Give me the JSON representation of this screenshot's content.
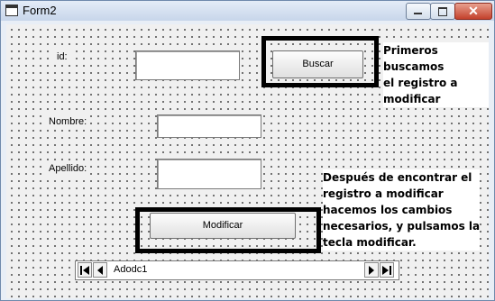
{
  "window": {
    "title": "Form2"
  },
  "form": {
    "id_label": "id:",
    "id_value": "",
    "search_button": "Buscar",
    "name_label": "Nombre:",
    "name_value": "",
    "surname_label": "Apellido:",
    "surname_value": "",
    "modify_button": "Modificar",
    "adodc_caption": "Adodc1"
  },
  "annotations": {
    "note_search": [
      "Primeros buscamos",
      "el registro a",
      "modificar"
    ],
    "note_modify": [
      "Después de encontrar el",
      "registro a modificar",
      "hacemos los cambios",
      "necesarios, y pulsamos la",
      "tecla modificar."
    ]
  },
  "icons": [
    "form-icon",
    "minimize-icon",
    "maximize-icon",
    "close-icon",
    "first-record-icon",
    "previous-record-icon",
    "next-record-icon",
    "last-record-icon"
  ],
  "colors": {
    "titlebar": "#c7d6ea",
    "close_button": "#c3412c",
    "form_background": "#f0f0f0",
    "highlight_frame": "#000000"
  }
}
